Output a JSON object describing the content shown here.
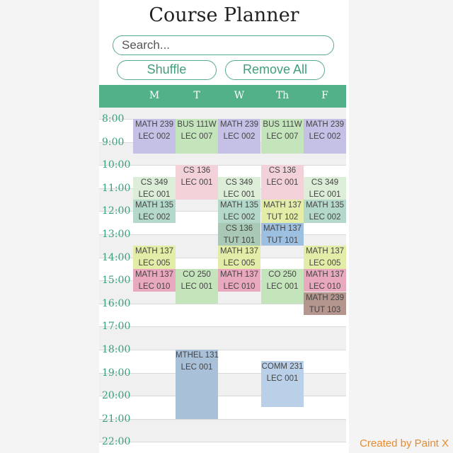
{
  "app": {
    "title": "Course Planner"
  },
  "search": {
    "placeholder": "Search..."
  },
  "buttons": {
    "shuffle": "Shuffle",
    "remove_all": "Remove All"
  },
  "days": [
    "M",
    "T",
    "W",
    "Th",
    "F"
  ],
  "hours": [
    "8:00",
    "9:00",
    "10:00",
    "11:00",
    "12:00",
    "13:00",
    "14:00",
    "15:00",
    "16:00",
    "17:00",
    "18:00",
    "19:00",
    "20:00",
    "21:00",
    "22:00"
  ],
  "colors": {
    "accent": "#53b18a",
    "purple": "#c5c0e6",
    "green": "#c4e4bb",
    "pink": "#f2d2d8",
    "lightgreen": "#dcedd8",
    "teal": "#b4d8c9",
    "tealdark": "#a9c9b6",
    "yellow": "#e4eda8",
    "rose": "#e8a8bd",
    "brown": "#b4968e",
    "blue": "#a9c1d8",
    "lightblue": "#b9d0e8",
    "blue2": "#9ec0e0"
  },
  "blocks": [
    {
      "day": 0,
      "start": 8.0,
      "end": 9.5,
      "l1": "MATH 239",
      "l2": "LEC 002",
      "color": "purple"
    },
    {
      "day": 1,
      "start": 8.0,
      "end": 9.5,
      "l1": "BUS 111W",
      "l2": "LEC 007",
      "color": "green"
    },
    {
      "day": 2,
      "start": 8.0,
      "end": 9.5,
      "l1": "MATH 239",
      "l2": "LEC 002",
      "color": "purple"
    },
    {
      "day": 3,
      "start": 8.0,
      "end": 9.5,
      "l1": "BUS 111W",
      "l2": "LEC 007",
      "color": "green"
    },
    {
      "day": 4,
      "start": 8.0,
      "end": 9.5,
      "l1": "MATH 239",
      "l2": "LEC 002",
      "color": "purple"
    },
    {
      "day": 1,
      "start": 10.0,
      "end": 11.5,
      "l1": "CS 136",
      "l2": "LEC 001",
      "color": "pink"
    },
    {
      "day": 3,
      "start": 10.0,
      "end": 11.5,
      "l1": "CS 136",
      "l2": "LEC 001",
      "color": "pink"
    },
    {
      "day": 0,
      "start": 10.5,
      "end": 11.5,
      "l1": "CS 349",
      "l2": "LEC 001",
      "color": "lightgreen"
    },
    {
      "day": 2,
      "start": 10.5,
      "end": 11.5,
      "l1": "CS 349",
      "l2": "LEC 001",
      "color": "lightgreen"
    },
    {
      "day": 4,
      "start": 10.5,
      "end": 11.5,
      "l1": "CS 349",
      "l2": "LEC 001",
      "color": "lightgreen"
    },
    {
      "day": 0,
      "start": 11.5,
      "end": 12.5,
      "l1": "MATH 135",
      "l2": "LEC 002",
      "color": "teal"
    },
    {
      "day": 2,
      "start": 11.5,
      "end": 12.5,
      "l1": "MATH 135",
      "l2": "LEC 002",
      "color": "teal"
    },
    {
      "day": 3,
      "start": 11.5,
      "end": 12.5,
      "l1": "MATH 137",
      "l2": "TUT 102",
      "color": "yellow"
    },
    {
      "day": 4,
      "start": 11.5,
      "end": 12.5,
      "l1": "MATH 135",
      "l2": "LEC 002",
      "color": "teal"
    },
    {
      "day": 2,
      "start": 12.5,
      "end": 13.5,
      "l1": "CS 136",
      "l2": "TUT 101",
      "color": "tealdark"
    },
    {
      "day": 3,
      "start": 12.5,
      "end": 13.5,
      "l1": "MATH 137",
      "l2": "TUT 101",
      "color": "blue2"
    },
    {
      "day": 0,
      "start": 13.5,
      "end": 14.5,
      "l1": "MATH 137",
      "l2": "LEC 005",
      "color": "yellow"
    },
    {
      "day": 2,
      "start": 13.5,
      "end": 14.5,
      "l1": "MATH 137",
      "l2": "LEC 005",
      "color": "yellow"
    },
    {
      "day": 4,
      "start": 13.5,
      "end": 14.5,
      "l1": "MATH 137",
      "l2": "LEC 005",
      "color": "yellow"
    },
    {
      "day": 0,
      "start": 14.5,
      "end": 15.5,
      "l1": "MATH 137",
      "l2": "LEC 010",
      "color": "rose"
    },
    {
      "day": 1,
      "start": 14.5,
      "end": 16.0,
      "l1": "CO 250",
      "l2": "LEC 001",
      "color": "green"
    },
    {
      "day": 2,
      "start": 14.5,
      "end": 15.5,
      "l1": "MATH 137",
      "l2": "LEC 010",
      "color": "rose"
    },
    {
      "day": 3,
      "start": 14.5,
      "end": 16.0,
      "l1": "CO 250",
      "l2": "LEC 001",
      "color": "green"
    },
    {
      "day": 4,
      "start": 14.5,
      "end": 15.5,
      "l1": "MATH 137",
      "l2": "LEC 010",
      "color": "rose"
    },
    {
      "day": 4,
      "start": 15.5,
      "end": 16.5,
      "l1": "MATH 239",
      "l2": "TUT 103",
      "color": "brown"
    },
    {
      "day": 1,
      "start": 18.0,
      "end": 21.0,
      "l1": "MTHEL 131",
      "l2": "LEC 001",
      "color": "blue"
    },
    {
      "day": 3,
      "start": 18.5,
      "end": 20.5,
      "l1": "COMM 231",
      "l2": "LEC 001",
      "color": "lightblue"
    }
  ],
  "credit": "Created by Paint X"
}
